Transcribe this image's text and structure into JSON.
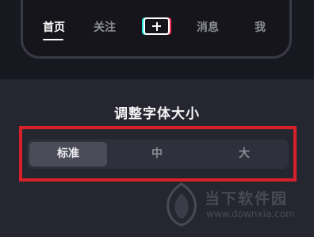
{
  "tab_bar": {
    "tabs": [
      {
        "label": "首页",
        "active": true
      },
      {
        "label": "关注",
        "active": false
      },
      {
        "label": "消息",
        "active": false
      },
      {
        "label": "我",
        "active": false
      }
    ],
    "create_icon": "plus-icon"
  },
  "font_size_sheet": {
    "title": "调整字体大小",
    "options": [
      "标准",
      "中",
      "大"
    ],
    "selected": "标准"
  },
  "watermark": {
    "name": "当下软件园",
    "url": "www.downxia.com"
  },
  "colors": {
    "highlight_border": "#d6202a",
    "plus_left_accent": "#25e6dc",
    "plus_right_accent": "#ff3058"
  }
}
